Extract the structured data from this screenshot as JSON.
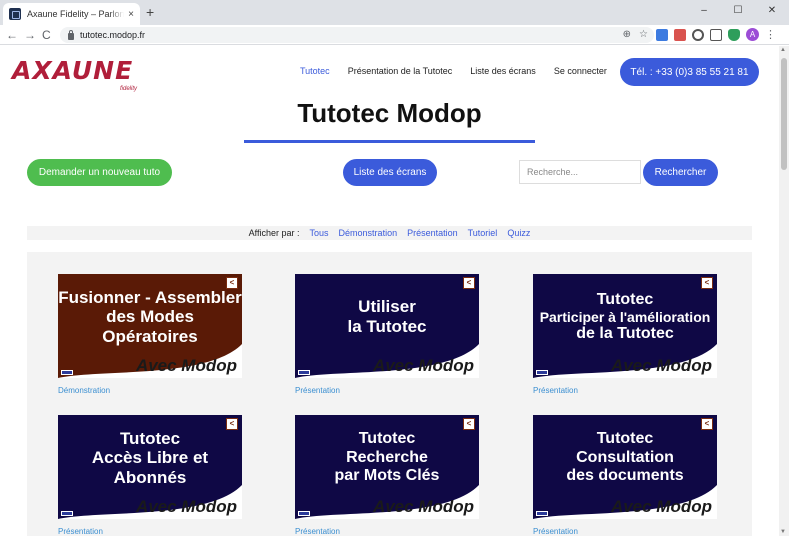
{
  "browser": {
    "tab_title": "Axaune Fidelity – Parlons bien, parlons",
    "tab_close": "×",
    "new_tab": "+",
    "url": "tutotec.modop.fr",
    "nav_back": "←",
    "nav_forward": "→",
    "nav_reload": "C",
    "win_minimize": "–",
    "win_maximize": "☐",
    "win_close": "✕",
    "zoom_icon": "⊕",
    "star_icon": "☆",
    "avatar_letter": "A",
    "menu": "⋮"
  },
  "site": {
    "logo": "AXAUNE",
    "logo_sub": "fidelity",
    "nav": [
      {
        "label": "Tutotec",
        "active": true
      },
      {
        "label": "Présentation de la Tutotec",
        "active": false
      },
      {
        "label": "Liste des écrans",
        "active": false
      },
      {
        "label": "Se connecter",
        "active": false
      }
    ],
    "phone": "Tél. : +33 (0)3 85 55 21 81"
  },
  "main": {
    "title": "Tutotec Modop",
    "request_button": "Demander un nouveau tuto",
    "screens_button": "Liste des écrans",
    "search_placeholder": "Recherche...",
    "search_button": "Rechercher"
  },
  "filter": {
    "label": "Afficher par :",
    "options": [
      "Tous",
      "Démonstration",
      "Présentation",
      "Tutoriel",
      "Quizz"
    ]
  },
  "cards": [
    {
      "lines": [
        "Fusionner - Assembler",
        "des Modes Opératoires"
      ],
      "category": "Démonstration",
      "bg": "#5a1a06"
    },
    {
      "lines": [
        "Utiliser",
        "la Tutotec"
      ],
      "category": "Présentation",
      "bg": "#0f0845"
    },
    {
      "lines": [
        "Tutotec",
        "Participer à l'amélioration",
        "de la Tutotec"
      ],
      "category": "Présentation",
      "bg": "#0f0845"
    },
    {
      "lines": [
        "Tutotec",
        "Accès Libre et Abonnés"
      ],
      "category": "Présentation",
      "bg": "#0f0845"
    },
    {
      "lines": [
        "Tutotec",
        "Recherche",
        "par Mots Clés"
      ],
      "category": "Présentation",
      "bg": "#0f0845"
    },
    {
      "lines": [
        "Tutotec",
        "Consultation",
        "des documents"
      ],
      "category": "Présentation",
      "bg": "#0f0845"
    }
  ],
  "card_signature": "Avec Modop",
  "card_mark": "<",
  "colors": {
    "accent_blue": "#3b5bdb",
    "green": "#4fbd4f",
    "brand_red": "#b01e3a"
  }
}
